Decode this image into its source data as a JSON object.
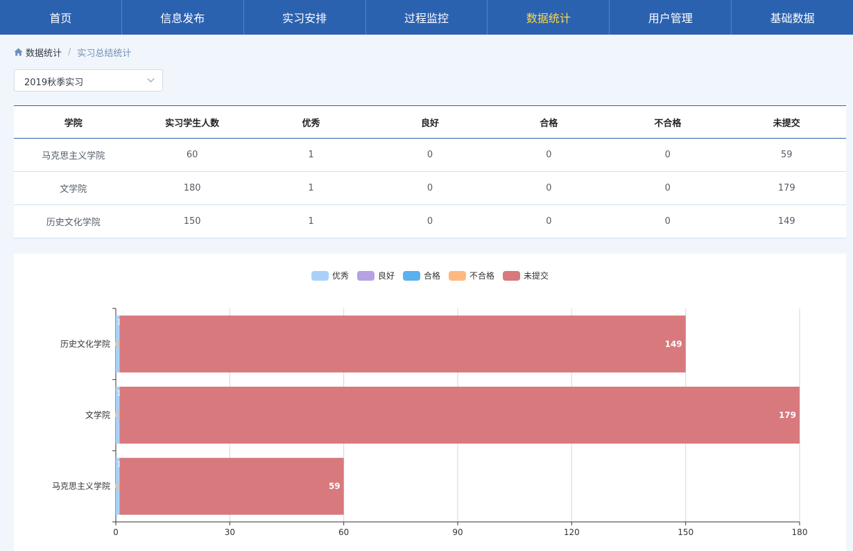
{
  "nav": {
    "items": [
      {
        "label": "首页",
        "active": false
      },
      {
        "label": "信息发布",
        "active": false
      },
      {
        "label": "实习安排",
        "active": false
      },
      {
        "label": "过程监控",
        "active": false
      },
      {
        "label": "数据统计",
        "active": true
      },
      {
        "label": "用户管理",
        "active": false
      },
      {
        "label": "基础数据",
        "active": false
      }
    ]
  },
  "breadcrumb": {
    "home": "数据统计",
    "separator": "/",
    "current": "实习总结统计"
  },
  "filter": {
    "selected": "2019秋季实习"
  },
  "table": {
    "headers": [
      "学院",
      "实习学生人数",
      "优秀",
      "良好",
      "合格",
      "不合格",
      "未提交"
    ],
    "rows": [
      [
        "马克思主义学院",
        "60",
        "1",
        "0",
        "0",
        "0",
        "59"
      ],
      [
        "文学院",
        "180",
        "1",
        "0",
        "0",
        "0",
        "179"
      ],
      [
        "历史文化学院",
        "150",
        "1",
        "0",
        "0",
        "0",
        "149"
      ]
    ]
  },
  "colors": {
    "nav_bg": "#2b62b0",
    "nav_active": "#ffd84a"
  },
  "chart_data": {
    "type": "bar",
    "orientation": "horizontal",
    "stacked": true,
    "categories": [
      "马克思主义学院",
      "文学院",
      "历史文化学院"
    ],
    "series": [
      {
        "name": "优秀",
        "color": "#a9d1f7",
        "values": [
          1,
          1,
          1
        ]
      },
      {
        "name": "良好",
        "color": "#b5a2e3",
        "values": [
          0,
          0,
          0
        ]
      },
      {
        "name": "合格",
        "color": "#5ab1ef",
        "values": [
          0,
          0,
          0
        ]
      },
      {
        "name": "不合格",
        "color": "#ffb980",
        "values": [
          0,
          0,
          0
        ]
      },
      {
        "name": "未提交",
        "color": "#d7797d",
        "values": [
          59,
          179,
          149
        ]
      }
    ],
    "xlim": [
      0,
      180
    ],
    "xticks": [
      0,
      30,
      60,
      90,
      120,
      150,
      180
    ],
    "legend_position": "top-center",
    "grid": true
  }
}
